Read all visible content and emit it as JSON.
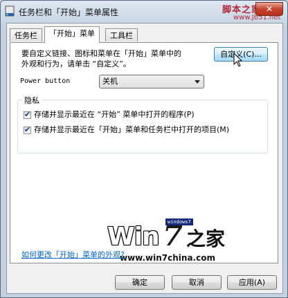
{
  "window": {
    "title": "任务栏和「开始」菜单属性",
    "close_label": "✕"
  },
  "watermark": {
    "site": "脚本之家",
    "url": "www.Jb51.net"
  },
  "tabs": [
    {
      "label": "任务栏"
    },
    {
      "label": "「开始」菜单"
    },
    {
      "label": "工具栏"
    }
  ],
  "panel": {
    "description_line1": "要自定义链接、图标和菜单在「开始」菜单中的",
    "description_line2": "外观和行为，请单击 “自定义”。",
    "customize_button": "自定义(C)...",
    "power_button_label": "Power button",
    "power_button_value": "关机",
    "privacy": {
      "title": "隐私",
      "options": [
        {
          "label": "存储并显示最近在 “开始” 菜单中打开的程序(P)",
          "checked": true
        },
        {
          "label": "存储并显示最近在「开始」菜单和任务栏中打开的项目(M)",
          "checked": true
        }
      ]
    }
  },
  "logo": {
    "win": "Win",
    "seven": "7",
    "tag": "windows7",
    "cn": "之家",
    "url": "www.win7china.com"
  },
  "help_link": "如何更改「开始」菜单的外观?",
  "footer": {
    "ok": "确定",
    "cancel": "取消",
    "apply": "应用(A)"
  },
  "colors": {
    "link": "#0066cc",
    "hot_button_border": "#3c7fb1",
    "watermark": "#b0263a"
  }
}
